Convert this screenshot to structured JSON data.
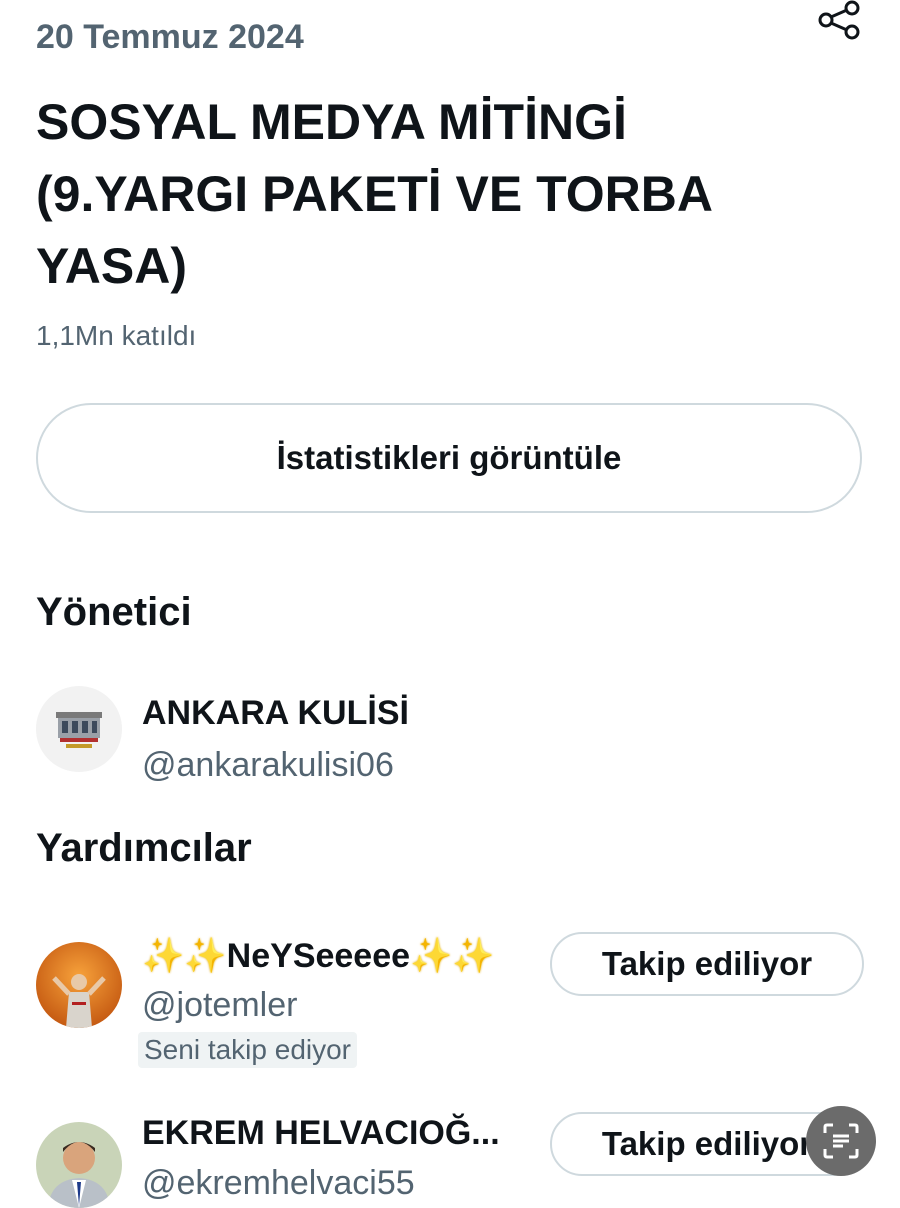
{
  "event": {
    "date": "20 Temmuz 2024",
    "title": "SOSYAL MEDYA MİTİNGİ\n(9.YARGI  PAKETİ VE TORBA\nYASA)",
    "participants": "1,1Mn katıldı",
    "stats_button_label": "İstatistikleri görüntüle"
  },
  "host_section": {
    "title": "Yönetici",
    "user": {
      "name": "ANKARA KULİSİ",
      "handle": "@ankarakulisi06",
      "avatar_icon": "building-logo-icon"
    }
  },
  "cohost_section": {
    "title": "Yardımcılar",
    "users": [
      {
        "name_text": "NeYSeeeee",
        "name_decoration_icon": "star-emoji-icon",
        "handle": "@jotemler",
        "follows_you": "Seni takip ediyor",
        "follow_button_label": "Takip ediliyor",
        "avatar_icon": "football-player-photo"
      },
      {
        "name": "EKREM HELVACIOĞ...",
        "handle": "@ekremhelvaci55",
        "follow_button_label": "Takip ediliyor",
        "avatar_icon": "man-in-suit-photo"
      }
    ]
  },
  "floating": {
    "scan_icon": "text-scan-icon"
  },
  "colors": {
    "primary_text": "#0f1419",
    "secondary_text": "#536471",
    "border": "#cfd9de",
    "star": "#f5c518"
  }
}
